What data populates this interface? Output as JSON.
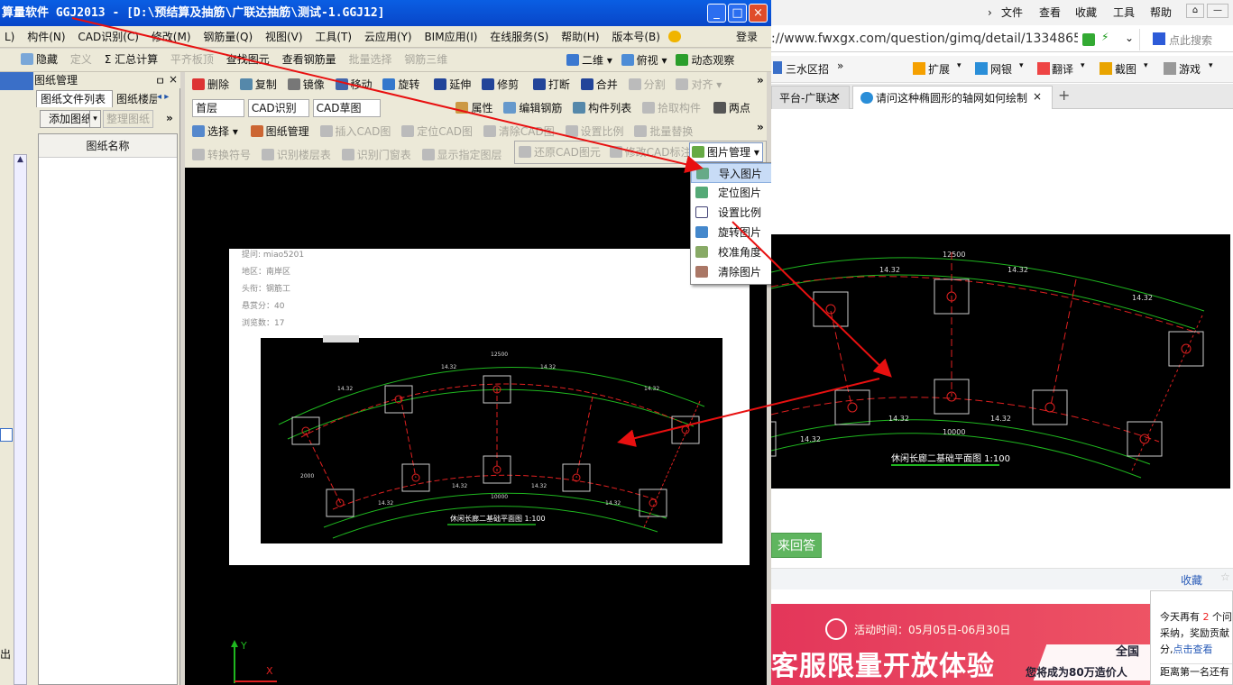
{
  "app": {
    "title": "算量软件 GGJ2013 - [D:\\预结算及抽筋\\广联达抽筋\\测试-1.GGJ12]",
    "win_controls": {
      "minimize": "_",
      "maximize": "□",
      "close": "×"
    },
    "menu": [
      "L)",
      "构件(N)",
      "CAD识别(C)",
      "修改(M)",
      "钢筋量(Q)",
      "视图(V)",
      "工具(T)",
      "云应用(Y)",
      "BIM应用(I)",
      "在线服务(S)",
      "帮助(H)",
      "版本号(B)"
    ],
    "login": "登录",
    "toolbar1": [
      "隐藏",
      "定义",
      "Σ 汇总计算",
      "平齐板顶",
      "查找图元",
      "查看钢筋量",
      "批量选择",
      "钢筋三维"
    ],
    "toolbar1_right": [
      "二维",
      "俯视",
      "动态观察"
    ],
    "toolbar2": [
      "删除",
      "复制",
      "镜像",
      "移动",
      "旋转",
      "延伸",
      "修剪",
      "打断",
      "合并",
      "分割",
      "对齐"
    ],
    "toolbar3": {
      "floor": "首层",
      "cad": "CAD识别",
      "cadview": "CAD草图",
      "items": [
        "属性",
        "编辑钢筋",
        "构件列表",
        "拾取构件",
        "两点"
      ]
    },
    "toolbar4": [
      "选择",
      "图纸管理",
      "插入CAD图",
      "定位CAD图",
      "清除CAD图",
      "设置比例",
      "批量替换"
    ],
    "toolbar5": [
      "转换符号",
      "识别楼层表",
      "识别门窗表",
      "显示指定图层",
      "还原CAD图元",
      "修改CAD标注",
      "图片管理"
    ],
    "leftpane": {
      "title": "图纸管理",
      "tabs": [
        "图纸文件列表",
        "图纸楼层"
      ],
      "add_btn": "添加图纸",
      "arrange_btn": "整理图纸",
      "col_header": "图纸名称",
      "edge_char": "出"
    },
    "dropdown": [
      "导入图片",
      "定位图片",
      "设置比例",
      "旋转图片",
      "校准角度",
      "清除图片"
    ],
    "inner_doc": {
      "lines": [
        "提问: miao5201",
        "地区：南岸区",
        "头衔：钢筋工",
        "悬赏分：40",
        "浏览数：17"
      ],
      "dims": [
        "12500",
        "14.32",
        "14.32",
        "14.32",
        "14.32",
        "10000",
        "14.32",
        "14.32",
        "14.32",
        "14.32",
        "2000"
      ],
      "drawing_title": "休闲长廊二基础平面图 1:100"
    },
    "axis": {
      "y": "Y",
      "x": "X"
    }
  },
  "browser": {
    "menu": [
      "文件",
      "查看",
      "收藏",
      "工具",
      "帮助"
    ],
    "url": "://www.fwxgx.com/question/gimq/detail/1334865.htr",
    "search_placeholder": "点此搜索",
    "favs": [
      "三水区招",
      "扩展",
      "网银",
      "翻译",
      "截图",
      "游戏"
    ],
    "tabs": [
      "平台-广联达",
      "请问这种椭圆形的轴网如何绘制"
    ],
    "new_tab": "+",
    "image": {
      "top": "12500",
      "dims": [
        "14.32",
        "14.32",
        "14.32",
        "14.32",
        "14.32",
        "14.32"
      ],
      "bottom": "10000",
      "title": "休闲长廊二基础平面图 1:100"
    },
    "answer_btn": "来回答",
    "collect": "收藏",
    "banner": {
      "time": "活动时间：05月05日-06月30日",
      "big": "客服限量开放体验",
      "right1": "全国",
      "right2": "您将成为80万造价人"
    },
    "popup": {
      "l1a": "今天再有",
      "num": "2",
      "l1b": "个问",
      "l2": "采纳，奖励贡献",
      "l3a": "分,",
      "link": "点击查看",
      "l4": "距离第一名还有"
    }
  },
  "colors": {
    "titlebar": "#0a5ee3",
    "accent": "#316ac5",
    "red_arrow": "#e81010",
    "green_line": "#1fb71f"
  }
}
